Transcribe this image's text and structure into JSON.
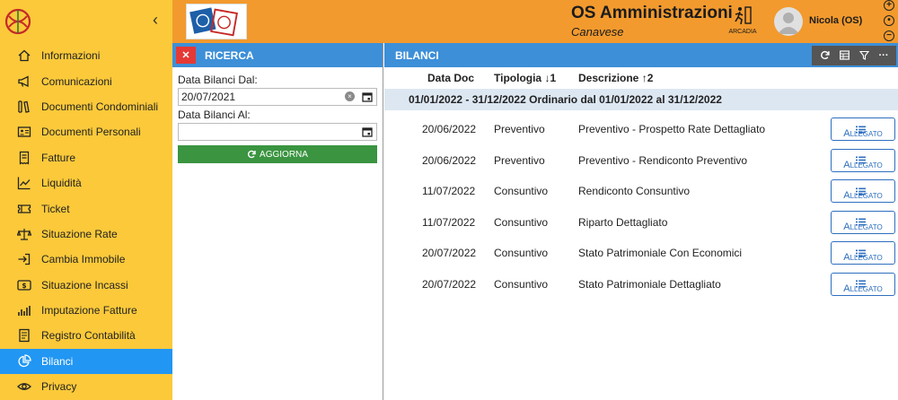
{
  "sidebar": {
    "items": [
      {
        "label": "Informazioni",
        "icon": "home-icon"
      },
      {
        "label": "Comunicazioni",
        "icon": "megaphone-icon"
      },
      {
        "label": "Documenti Condominiali",
        "icon": "books-icon"
      },
      {
        "label": "Documenti Personali",
        "icon": "id-card-icon"
      },
      {
        "label": "Fatture",
        "icon": "receipt-icon"
      },
      {
        "label": "Liquidità",
        "icon": "line-chart-icon"
      },
      {
        "label": "Ticket",
        "icon": "ticket-icon"
      },
      {
        "label": "Situazione Rate",
        "icon": "scale-icon"
      },
      {
        "label": "Cambia Immobile",
        "icon": "sign-in-icon"
      },
      {
        "label": "Situazione Incassi",
        "icon": "cash-icon"
      },
      {
        "label": "Imputazione Fatture",
        "icon": "bar-chart-icon"
      },
      {
        "label": "Registro Contabilità",
        "icon": "ledger-icon"
      },
      {
        "label": "Bilanci",
        "icon": "pie-chart-icon",
        "active": true
      },
      {
        "label": "Privacy",
        "icon": "eye-icon"
      }
    ]
  },
  "header": {
    "title": "OS Amministrazioni",
    "subtitle": "Canavese",
    "arcadia_label": "ARCADIA",
    "username": "Nicola (OS)",
    "zoom_in": "+",
    "zoom_reset": "•",
    "zoom_out": "−"
  },
  "search": {
    "title": "RICERCA",
    "close_label": "✕",
    "from_label": "Data Bilanci Dal:",
    "from_value": "20/07/2021",
    "to_label": "Data Bilanci Al:",
    "to_value": "",
    "refresh_label": "AGGIORNA"
  },
  "main": {
    "title": "BILANCI",
    "columns": {
      "date": "Data Doc",
      "type": "Tipologia ↓1",
      "desc": "Descrizione ↑2"
    },
    "group": "01/01/2022 - 31/12/2022 Ordinario dal 01/01/2022 al 31/12/2022",
    "attachment_label": "Allegato",
    "rows": [
      {
        "date": "20/06/2022",
        "type": "Preventivo",
        "desc": "Preventivo - Prospetto Rate Dettagliato"
      },
      {
        "date": "20/06/2022",
        "type": "Preventivo",
        "desc": "Preventivo - Rendiconto Preventivo"
      },
      {
        "date": "11/07/2022",
        "type": "Consuntivo",
        "desc": "Rendiconto Consuntivo"
      },
      {
        "date": "11/07/2022",
        "type": "Consuntivo",
        "desc": "Riparto Dettagliato"
      },
      {
        "date": "20/07/2022",
        "type": "Consuntivo",
        "desc": "Stato Patrimoniale Con Economici"
      },
      {
        "date": "20/07/2022",
        "type": "Consuntivo",
        "desc": "Stato Patrimoniale Dettagliato"
      }
    ]
  },
  "colors": {
    "sidebar_bg": "#fbc93a",
    "header_bg": "#f29a2e",
    "panel_bar": "#3d8fd8",
    "active_item": "#2196f3",
    "refresh_btn": "#3a9440",
    "close_btn": "#e53935",
    "group_row": "#dde7f2"
  }
}
